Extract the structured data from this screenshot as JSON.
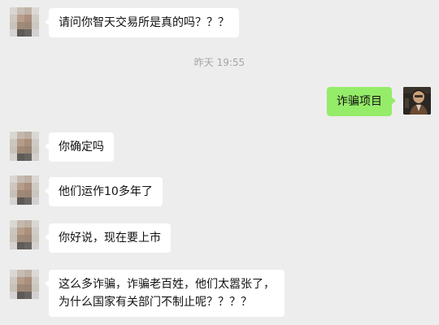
{
  "timestamp": "昨天 19:55",
  "messages": [
    {
      "side": "left",
      "lines": [
        "请问你智天交易所是真的吗？？？"
      ]
    },
    {
      "side": "right",
      "lines": [
        "诈骗项目"
      ]
    },
    {
      "side": "left",
      "lines": [
        "你确定吗"
      ]
    },
    {
      "side": "left",
      "lines": [
        "他们运作10多年了"
      ]
    },
    {
      "side": "left",
      "lines": [
        "你好说，现在要上市"
      ]
    },
    {
      "side": "left",
      "lines": [
        "这么多诈骗，诈骗老百姓，他们太嚣张了，",
        "为什么国家有关部门不制止呢？？？？"
      ]
    }
  ],
  "colors": {
    "background": "#ededed",
    "incoming_bubble": "#ffffff",
    "outgoing_bubble": "#95ec69",
    "timestamp_text": "#a6a6a6"
  },
  "avatars": {
    "contact": "pixelated-avatar",
    "me": "photo-avatar"
  }
}
